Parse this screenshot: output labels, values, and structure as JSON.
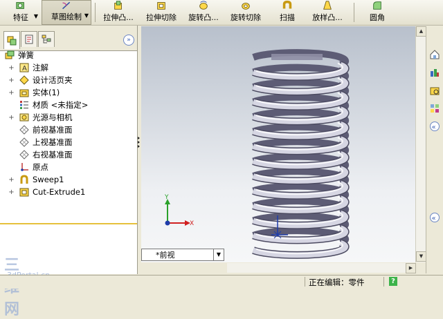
{
  "toolbar": {
    "features_label": "特征",
    "sketch_label": "草图绘制",
    "items": [
      {
        "label": "拉伸凸..."
      },
      {
        "label": "拉伸切除"
      },
      {
        "label": "旋转凸..."
      },
      {
        "label": "旋转切除"
      },
      {
        "label": "扫描"
      },
      {
        "label": "放样凸..."
      },
      {
        "label": "圆角"
      }
    ]
  },
  "tree": {
    "root": "弹簧",
    "items": [
      {
        "label": "注解",
        "expandable": true,
        "icon": "annotation-icon"
      },
      {
        "label": "设计活页夹",
        "expandable": true,
        "icon": "design-binder-icon"
      },
      {
        "label": "实体(1)",
        "expandable": true,
        "icon": "solid-bodies-icon"
      },
      {
        "label": "材质 <未指定>",
        "expandable": false,
        "icon": "material-icon"
      },
      {
        "label": "光源与相机",
        "expandable": true,
        "icon": "lights-cameras-icon"
      },
      {
        "label": "前视基准面",
        "expandable": false,
        "icon": "plane-icon"
      },
      {
        "label": "上视基准面",
        "expandable": false,
        "icon": "plane-icon"
      },
      {
        "label": "右视基准面",
        "expandable": false,
        "icon": "plane-icon"
      },
      {
        "label": "原点",
        "expandable": false,
        "icon": "origin-icon"
      },
      {
        "label": "Sweep1",
        "expandable": true,
        "icon": "sweep-icon"
      },
      {
        "label": "Cut-Extrude1",
        "expandable": true,
        "icon": "cut-extrude-icon"
      }
    ]
  },
  "viewport": {
    "view_name": "*前视",
    "axis_y": "Y",
    "axis_x": "X"
  },
  "status": {
    "text": "正在编辑：零件",
    "help": "?"
  },
  "watermark": {
    "line1": "三维网",
    "line2": "3dPortal.cn"
  },
  "colors": {
    "accent_yellow": "#e6c13a",
    "axis_y": "#2aa12a",
    "axis_x": "#d02020",
    "origin": "#1e3caa"
  }
}
